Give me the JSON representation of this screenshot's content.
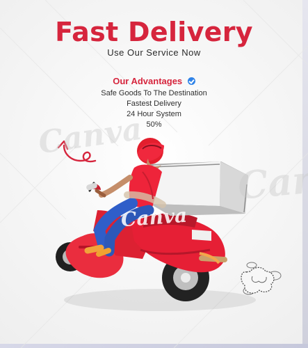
{
  "poster": {
    "title": "Fast Delivery",
    "subtitle": "Use Our Service Now",
    "advantages_title": "Our Advantages",
    "advantages": [
      "Safe Goods To The Destination",
      "Fastest Delivery",
      "24 Hour System",
      "50%"
    ],
    "watermarks": [
      "Canva",
      "Canva",
      "Canva"
    ]
  },
  "colors": {
    "accent": "#d6253d",
    "verified": "#2f83e8",
    "text": "#2f2f2f"
  },
  "icons": {
    "verified": "check-badge-icon",
    "arrow": "curved-arrow-icon",
    "smoke": "smoke-puff-icon"
  }
}
